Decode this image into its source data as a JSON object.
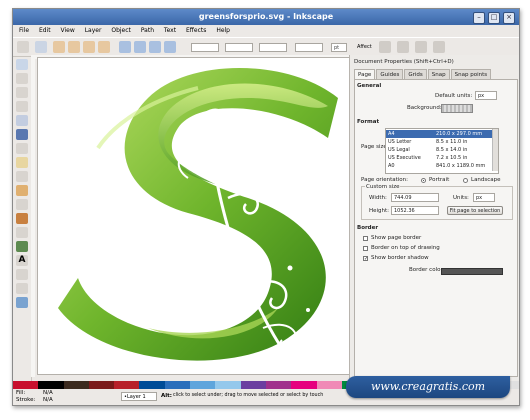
{
  "window": {
    "title": "greensforsprio.svg - Inkscape"
  },
  "menu": [
    "File",
    "Edit",
    "View",
    "Layer",
    "Object",
    "Path",
    "Text",
    "Effects",
    "Help"
  ],
  "toolbar": {
    "zoom": "pt",
    "affect_label": "Affect"
  },
  "panel": {
    "title": "Document Properties (Shift+Ctrl+D)",
    "tabs": [
      "Page",
      "Guides",
      "Grids",
      "Snap",
      "Snap points"
    ],
    "general": "General",
    "default_units_label": "Default units:",
    "default_units_value": "px",
    "background_label": "Background:",
    "format": "Format",
    "page_size_label": "Page size:",
    "page_sizes": [
      {
        "name": "A4",
        "dims": "210.0 x 297.0 mm"
      },
      {
        "name": "US Letter",
        "dims": "8.5 x 11.0 in"
      },
      {
        "name": "US Legal",
        "dims": "8.5 x 14.0 in"
      },
      {
        "name": "US Executive",
        "dims": "7.2 x 10.5 in"
      },
      {
        "name": "A0",
        "dims": "841.0 x 1189.0 mm"
      }
    ],
    "orientation_label": "Page orientation:",
    "portrait": "Portrait",
    "landscape": "Landscape",
    "custom_size": "Custom size",
    "width_label": "Width:",
    "width_value": "744.09",
    "height_label": "Height:",
    "height_value": "1052.36",
    "units_label": "Units:",
    "units_value": "px",
    "fit_button": "Fit page to selection",
    "border": "Border",
    "show_border": "Show page border",
    "border_on_top": "Border on top of drawing",
    "show_shadow": "Show border shadow",
    "border_color_label": "Border color:",
    "border_color": "#555555"
  },
  "status": {
    "fill_label": "Fill:",
    "fill_value": "N/A",
    "stroke_label": "Stroke:",
    "stroke_value": "N/A",
    "layer": "•Layer 1",
    "alt_label": "Alt:",
    "hint": "click to select under; drag to move selected or select by touch"
  },
  "watermark": "www.creagratis.com",
  "palette": [
    "#c8102e",
    "#000000",
    "#3b2a1e",
    "#7a1a1a",
    "#b8202a",
    "#004c97",
    "#2a6ebb",
    "#5fa5dc",
    "#94c8ec",
    "#6b3fa0",
    "#a0328c",
    "#e6007e",
    "#f08ab6",
    "#008a3e",
    "#5db346",
    "#b5d335",
    "#ffd100",
    "#f7a800",
    "#ef7d00",
    "#e0e0e0"
  ]
}
